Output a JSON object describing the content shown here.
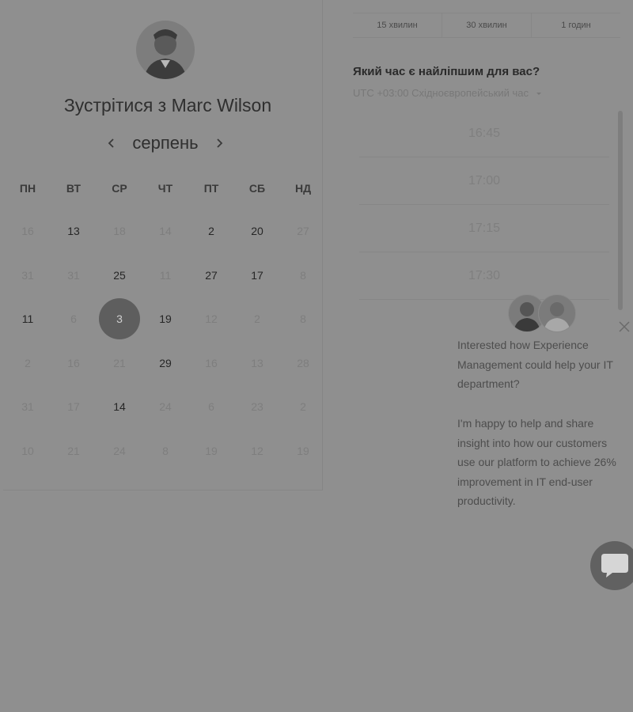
{
  "organizer": {
    "meet_with": "Зустрітися з Marc Wilson"
  },
  "calendar": {
    "month": "серпень",
    "weekdays": [
      "ПН",
      "ВТ",
      "СР",
      "ЧТ",
      "ПТ",
      "СБ",
      "НД"
    ],
    "weeks": [
      [
        {
          "d": "16",
          "s": "muted"
        },
        {
          "d": "13",
          "s": "avail"
        },
        {
          "d": "18",
          "s": "muted"
        },
        {
          "d": "14",
          "s": "muted"
        },
        {
          "d": "2",
          "s": "avail"
        },
        {
          "d": "20",
          "s": "avail"
        },
        {
          "d": "27",
          "s": "muted"
        }
      ],
      [
        {
          "d": "31",
          "s": "muted"
        },
        {
          "d": "31",
          "s": "muted"
        },
        {
          "d": "25",
          "s": "avail"
        },
        {
          "d": "11",
          "s": "muted"
        },
        {
          "d": "27",
          "s": "avail"
        },
        {
          "d": "17",
          "s": "avail"
        },
        {
          "d": "8",
          "s": "muted"
        }
      ],
      [
        {
          "d": "11",
          "s": "avail"
        },
        {
          "d": "6",
          "s": "muted"
        },
        {
          "d": "3",
          "s": "sel"
        },
        {
          "d": "19",
          "s": "avail"
        },
        {
          "d": "12",
          "s": "muted"
        },
        {
          "d": "2",
          "s": "muted"
        },
        {
          "d": "8",
          "s": "muted"
        }
      ],
      [
        {
          "d": "2",
          "s": "muted"
        },
        {
          "d": "16",
          "s": "muted"
        },
        {
          "d": "21",
          "s": "muted"
        },
        {
          "d": "29",
          "s": "avail"
        },
        {
          "d": "16",
          "s": "muted"
        },
        {
          "d": "13",
          "s": "muted"
        },
        {
          "d": "28",
          "s": "muted"
        }
      ],
      [
        {
          "d": "31",
          "s": "muted"
        },
        {
          "d": "17",
          "s": "muted"
        },
        {
          "d": "14",
          "s": "avail"
        },
        {
          "d": "24",
          "s": "muted"
        },
        {
          "d": "6",
          "s": "muted"
        },
        {
          "d": "23",
          "s": "muted"
        },
        {
          "d": "2",
          "s": "muted"
        }
      ],
      [
        {
          "d": "10",
          "s": "muted"
        },
        {
          "d": "21",
          "s": "muted"
        },
        {
          "d": "24",
          "s": "muted"
        },
        {
          "d": "8",
          "s": "muted"
        },
        {
          "d": "19",
          "s": "muted"
        },
        {
          "d": "12",
          "s": "muted"
        },
        {
          "d": "19",
          "s": "muted"
        }
      ]
    ]
  },
  "duration_tabs": [
    "15 хвилин",
    "30 хвилин",
    "1 годин"
  ],
  "time_picker": {
    "question": "Який час є найліпшим для вас?",
    "timezone": "UTC +03:00 Східноєвропейський час",
    "slots": [
      "16:45",
      "17:00",
      "17:15",
      "17:30"
    ]
  },
  "chat_popup": {
    "message_1": "Interested how Experience Management could help your IT department?",
    "message_2": "I'm happy to help and share insight into how our customers use our platform to achieve 26% improvement in IT end-user productivity."
  },
  "icons": {
    "prev": "chevron-left-icon",
    "next": "chevron-right-icon",
    "tz_dropdown": "caret-down-icon",
    "close": "close-icon",
    "chat": "chat-bubble-icon"
  }
}
